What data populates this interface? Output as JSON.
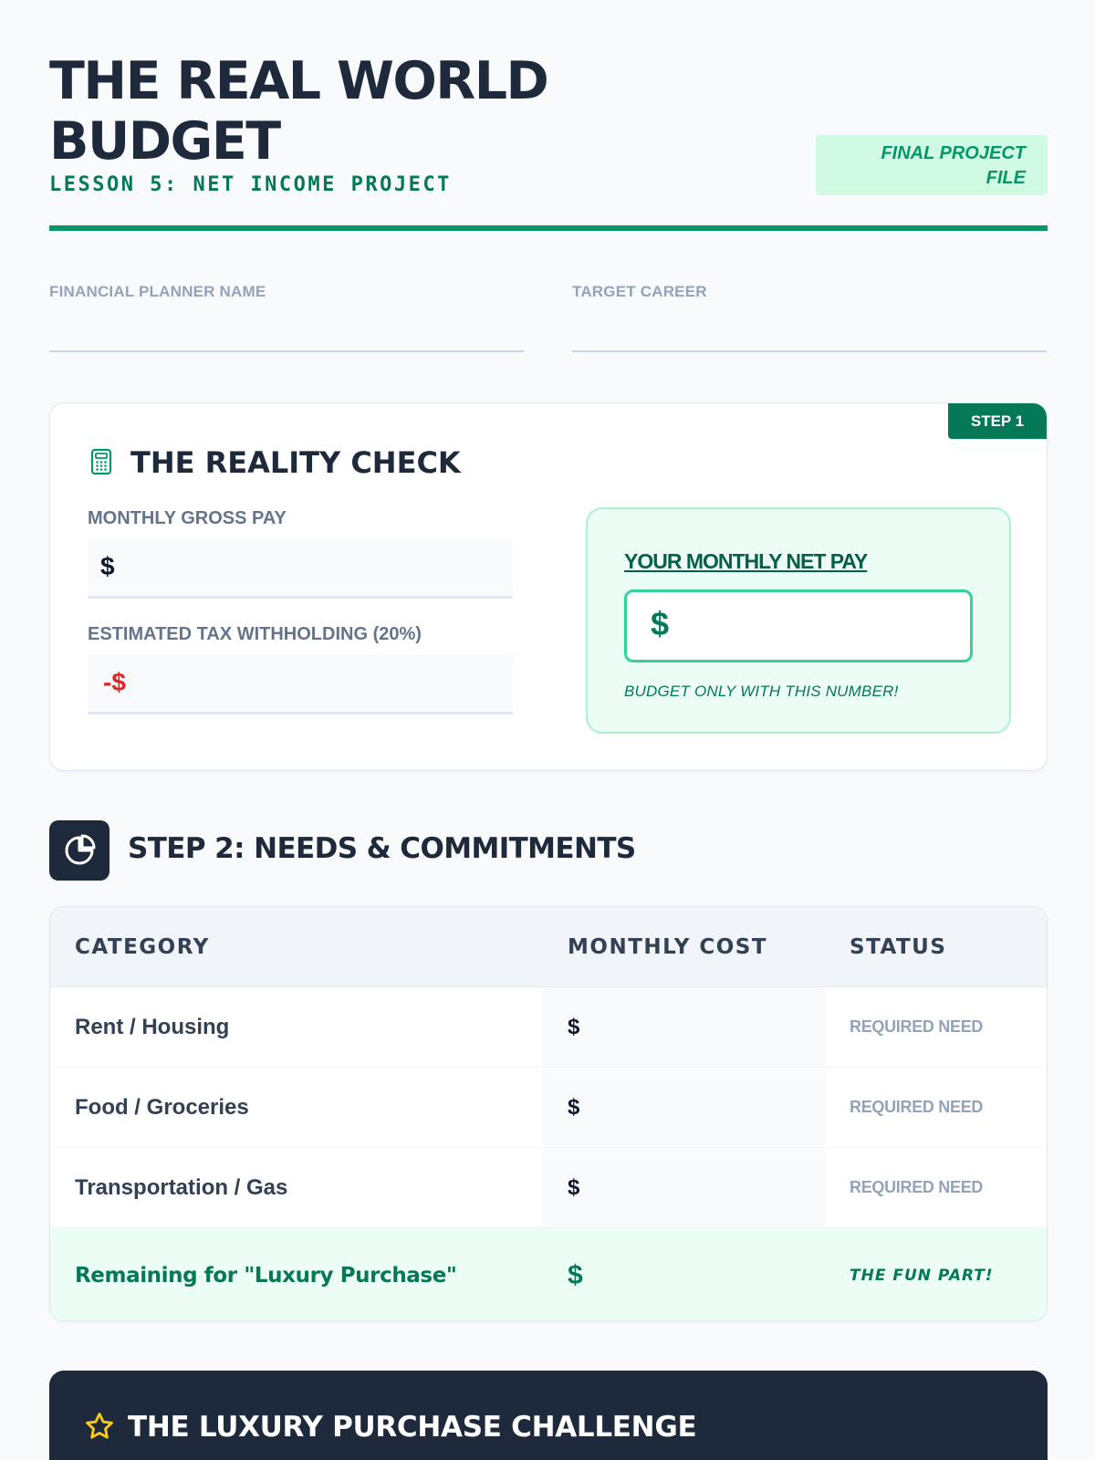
{
  "header": {
    "title": "THE REAL WORLD BUDGET",
    "subtitle": "LESSON 5: NET INCOME PROJECT",
    "badge": "FINAL PROJECT FILE"
  },
  "fields": {
    "planner_label": "FINANCIAL PLANNER NAME",
    "career_label": "TARGET CAREER"
  },
  "step1": {
    "tab": "STEP 1",
    "title": "THE REALITY CHECK",
    "gross_label": "MONTHLY GROSS PAY",
    "gross_prefix": "$",
    "tax_label": "ESTIMATED TAX WITHHOLDING (20%)",
    "tax_prefix": "-$",
    "net_label": "YOUR MONTHLY NET PAY",
    "net_prefix": "$",
    "net_note": "BUDGET ONLY WITH THIS NUMBER!"
  },
  "step2": {
    "title": "STEP 2: NEEDS & COMMITMENTS",
    "columns": [
      "CATEGORY",
      "MONTHLY COST",
      "STATUS"
    ],
    "rows": [
      {
        "category": "Rent / Housing",
        "cost": "$",
        "status": "REQUIRED NEED"
      },
      {
        "category": "Food / Groceries",
        "cost": "$",
        "status": "REQUIRED NEED"
      },
      {
        "category": "Transportation / Gas",
        "cost": "$",
        "status": "REQUIRED NEED"
      }
    ],
    "total": {
      "category": "Remaining for \"Luxury Purchase\"",
      "cost": "$",
      "status": "THE FUN PART!"
    }
  },
  "luxury": {
    "title": "THE LUXURY PURCHASE CHALLENGE",
    "icon": "star-icon"
  },
  "colors": {
    "accent": "#059669",
    "dark": "#1e293b",
    "negative": "#dc2626"
  }
}
